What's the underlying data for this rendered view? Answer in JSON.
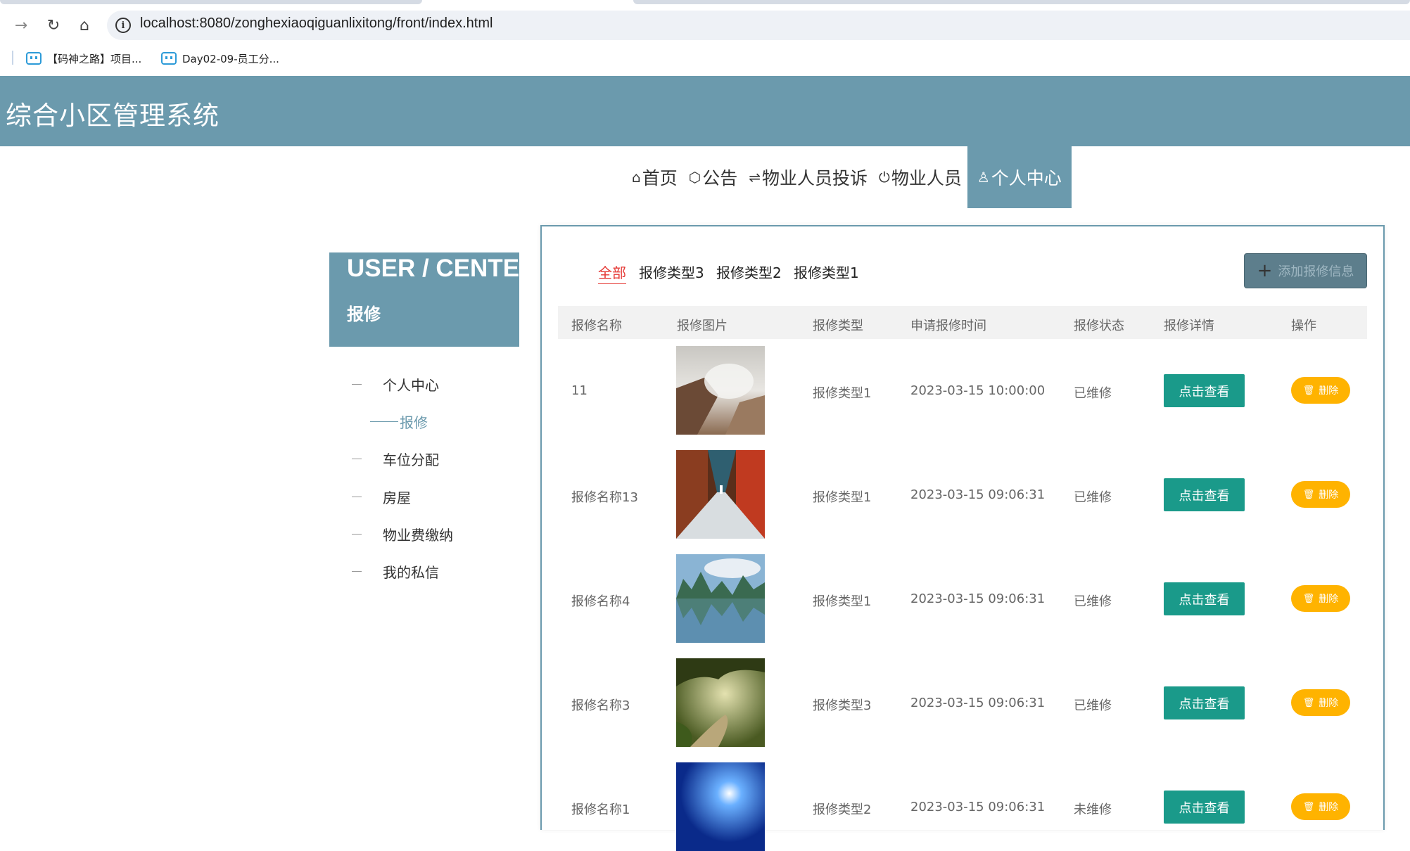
{
  "browser": {
    "url": "localhost:8080/zonghexiaoqiguanlixitong/front/index.html",
    "bookmarks": [
      {
        "label": "【码神之路】项目..."
      },
      {
        "label": "Day02-09-员工分..."
      }
    ]
  },
  "site": {
    "title": "综合小区管理系统"
  },
  "nav": {
    "items": [
      {
        "icon": "⌂",
        "label": "首页"
      },
      {
        "icon": "⬡",
        "label": "公告"
      },
      {
        "icon": "⇌",
        "label": "物业人员投诉"
      },
      {
        "icon": "⏻",
        "label": "物业人员"
      },
      {
        "icon": "♙",
        "label": "个人中心",
        "active": true
      }
    ]
  },
  "sidebar": {
    "title": "USER / CENTER",
    "subtitle": "报修",
    "items": [
      {
        "label": "个人中心"
      },
      {
        "label": "报修",
        "active": true
      },
      {
        "label": "车位分配"
      },
      {
        "label": "房屋"
      },
      {
        "label": "物业费缴纳"
      },
      {
        "label": "我的私信"
      }
    ]
  },
  "filters": [
    "全部",
    "报修类型3",
    "报修类型2",
    "报修类型1"
  ],
  "add_button": {
    "label": "添加报修信息"
  },
  "table": {
    "headers": [
      "报修名称",
      "报修图片",
      "报修类型",
      "申请报修时间",
      "报修状态",
      "报修详情",
      "操作"
    ],
    "rows": [
      {
        "name": "11",
        "type": "报修类型1",
        "time": "2023-03-15 10:00:00",
        "status": "已维修",
        "view": "点击查看",
        "delete": "删除"
      },
      {
        "name": "报修名称13",
        "type": "报修类型1",
        "time": "2023-03-15 09:06:31",
        "status": "已维修",
        "view": "点击查看",
        "delete": "删除"
      },
      {
        "name": "报修名称4",
        "type": "报修类型1",
        "time": "2023-03-15 09:06:31",
        "status": "已维修",
        "view": "点击查看",
        "delete": "删除"
      },
      {
        "name": "报修名称3",
        "type": "报修类型3",
        "time": "2023-03-15 09:06:31",
        "status": "已维修",
        "view": "点击查看",
        "delete": "删除"
      },
      {
        "name": "报修名称1",
        "type": "报修类型2",
        "time": "2023-03-15 09:06:31",
        "status": "未维修",
        "view": "点击查看",
        "delete": "删除"
      }
    ]
  },
  "colors": {
    "accent": "#6b9aad",
    "view_button": "#1a9a8a",
    "delete_button": "#ffb300",
    "active_filter": "#e53935"
  }
}
